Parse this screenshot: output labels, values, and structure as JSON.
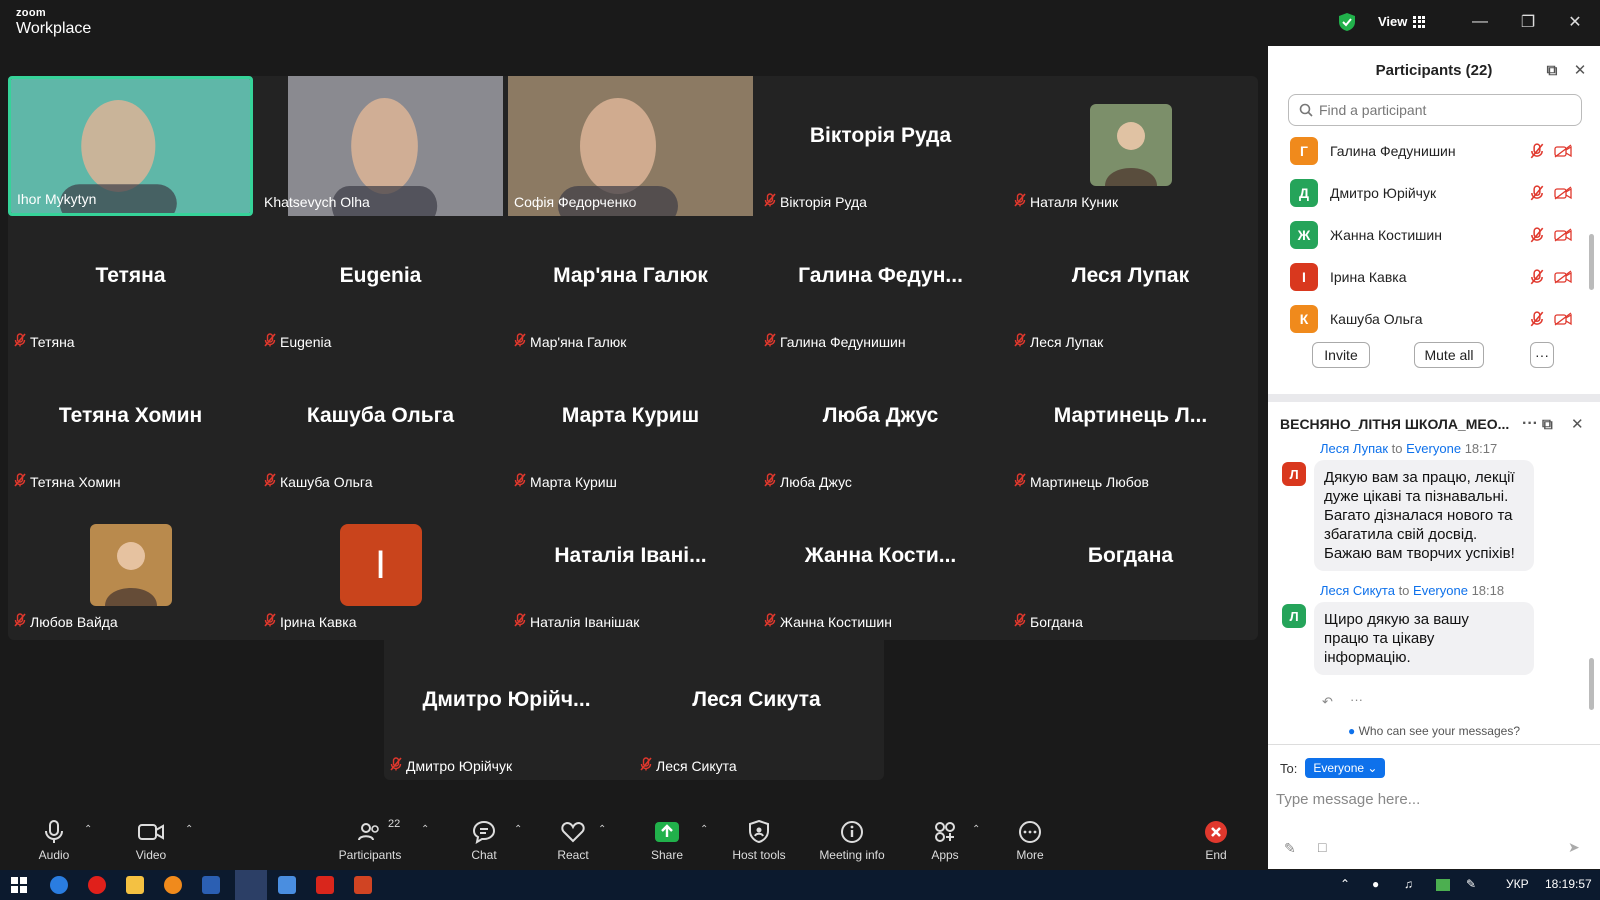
{
  "app": {
    "logo_line1": "zoom",
    "logo_line2": "Workplace",
    "view_label": "View"
  },
  "tiles": [
    {
      "display": "",
      "label": "Ihor Mykytyn",
      "type": "video",
      "active": true,
      "muted": false,
      "bg": "#5fb7a8"
    },
    {
      "display": "",
      "label": "Khatsevych Olha",
      "type": "video",
      "muted": false,
      "bg": "#8a8a90"
    },
    {
      "display": "",
      "label": "Софія Федорченко",
      "type": "video",
      "muted": false,
      "bg": "#8c7a63"
    },
    {
      "display": "Вікторія Руда",
      "label": "Вікторія Руда",
      "type": "name",
      "muted": true
    },
    {
      "display": "",
      "label": "Наталя Куник",
      "type": "photo",
      "muted": true,
      "photo_color": "#7c8f6a"
    },
    {
      "display": "Тетяна",
      "label": "Тетяна",
      "type": "name",
      "muted": true
    },
    {
      "display": "Eugenia",
      "label": "Eugenia",
      "type": "name",
      "muted": true
    },
    {
      "display": "Мар'яна Галюк",
      "label": "Мар'яна Галюк",
      "type": "name",
      "muted": true
    },
    {
      "display": "Галина Федун...",
      "label": "Галина Федунишин",
      "type": "name",
      "muted": true
    },
    {
      "display": "Леся Лупак",
      "label": "Леся Лупак",
      "type": "name",
      "muted": true
    },
    {
      "display": "Тетяна Хомин",
      "label": "Тетяна Хомин",
      "type": "name",
      "muted": true
    },
    {
      "display": "Кашуба Ольга",
      "label": "Кашуба Ольга",
      "type": "name",
      "muted": true
    },
    {
      "display": "Марта Куриш",
      "label": "Марта Куриш",
      "type": "name",
      "muted": true
    },
    {
      "display": "Люба Джус",
      "label": "Люба Джус",
      "type": "name",
      "muted": true
    },
    {
      "display": "Мартинець Л...",
      "label": "Мартинець Любов",
      "type": "name",
      "muted": true
    },
    {
      "display": "",
      "label": "Любов Вайда",
      "type": "photo",
      "muted": true,
      "photo_color": "#b98a4d"
    },
    {
      "display": "І",
      "label": "Ірина Кавка",
      "type": "letter",
      "muted": true
    },
    {
      "display": "Наталія Івані...",
      "label": "Наталія Іванішак",
      "type": "name",
      "muted": true
    },
    {
      "display": "Жанна Кости...",
      "label": "Жанна Костишин",
      "type": "name",
      "muted": true
    },
    {
      "display": "Богдана",
      "label": "Богдана",
      "type": "name",
      "muted": true
    },
    {
      "display": "Дмитро Юрійч...",
      "label": "Дмитро Юрійчук",
      "type": "name",
      "muted": true
    },
    {
      "display": "Леся Сикута",
      "label": "Леся Сикута",
      "type": "name",
      "muted": true
    }
  ],
  "toolbar": {
    "audio": "Audio",
    "video": "Video",
    "participants": "Participants",
    "participants_count": "22",
    "chat": "Chat",
    "react": "React",
    "share": "Share",
    "host_tools": "Host tools",
    "meeting_info": "Meeting info",
    "apps": "Apps",
    "more": "More",
    "end": "End"
  },
  "participants_panel": {
    "title": "Participants (22)",
    "search_placeholder": "Find a participant",
    "list": [
      {
        "initial": "Г",
        "name": "Галина Федунишин",
        "color": "#f08a1c"
      },
      {
        "initial": "Д",
        "name": "Дмитро Юрійчук",
        "color": "#25a45a"
      },
      {
        "initial": "Ж",
        "name": "Жанна Костишин",
        "color": "#25a45a"
      },
      {
        "initial": "І",
        "name": "Ірина Кавка",
        "color": "#d9381e"
      },
      {
        "initial": "К",
        "name": "Кашуба Ольга",
        "color": "#f08a1c"
      }
    ],
    "invite": "Invite",
    "mute_all": "Mute all",
    "more": "···"
  },
  "chat_panel": {
    "title": "ВЕСНЯНО_ЛІТНЯ ШКОЛА_МЕО...",
    "messages": [
      {
        "sender": "Леся Лупак",
        "to_word": "to",
        "to": "Everyone",
        "time": "18:17",
        "initial": "Л",
        "color": "#d9381e",
        "lines": [
          "Дякую вам за працю, лекції",
          "дуже цікаві та пізнавальні.",
          "Багато дізналася нового та",
          "збагатила свій досвід.",
          "Бажаю вам творчих успіхів!"
        ]
      },
      {
        "sender": "Леся Сикута",
        "to_word": "to",
        "to": "Everyone",
        "time": "18:18",
        "initial": "Л",
        "color": "#25a45a",
        "lines": [
          "Щиро дякую за вашу",
          "працю та цікаву",
          "інформацію."
        ]
      }
    ],
    "who_can_see": "Who can see your messages?",
    "to_label": "To:",
    "recipient": "Everyone",
    "input_placeholder": "Type message here..."
  },
  "taskbar": {
    "lang": "УКР",
    "time": "18:19:57"
  },
  "colors": {
    "accent": "#0e71eb",
    "active_border": "#36d399",
    "mute_red": "#e0382d",
    "share_green": "#21b14b"
  }
}
